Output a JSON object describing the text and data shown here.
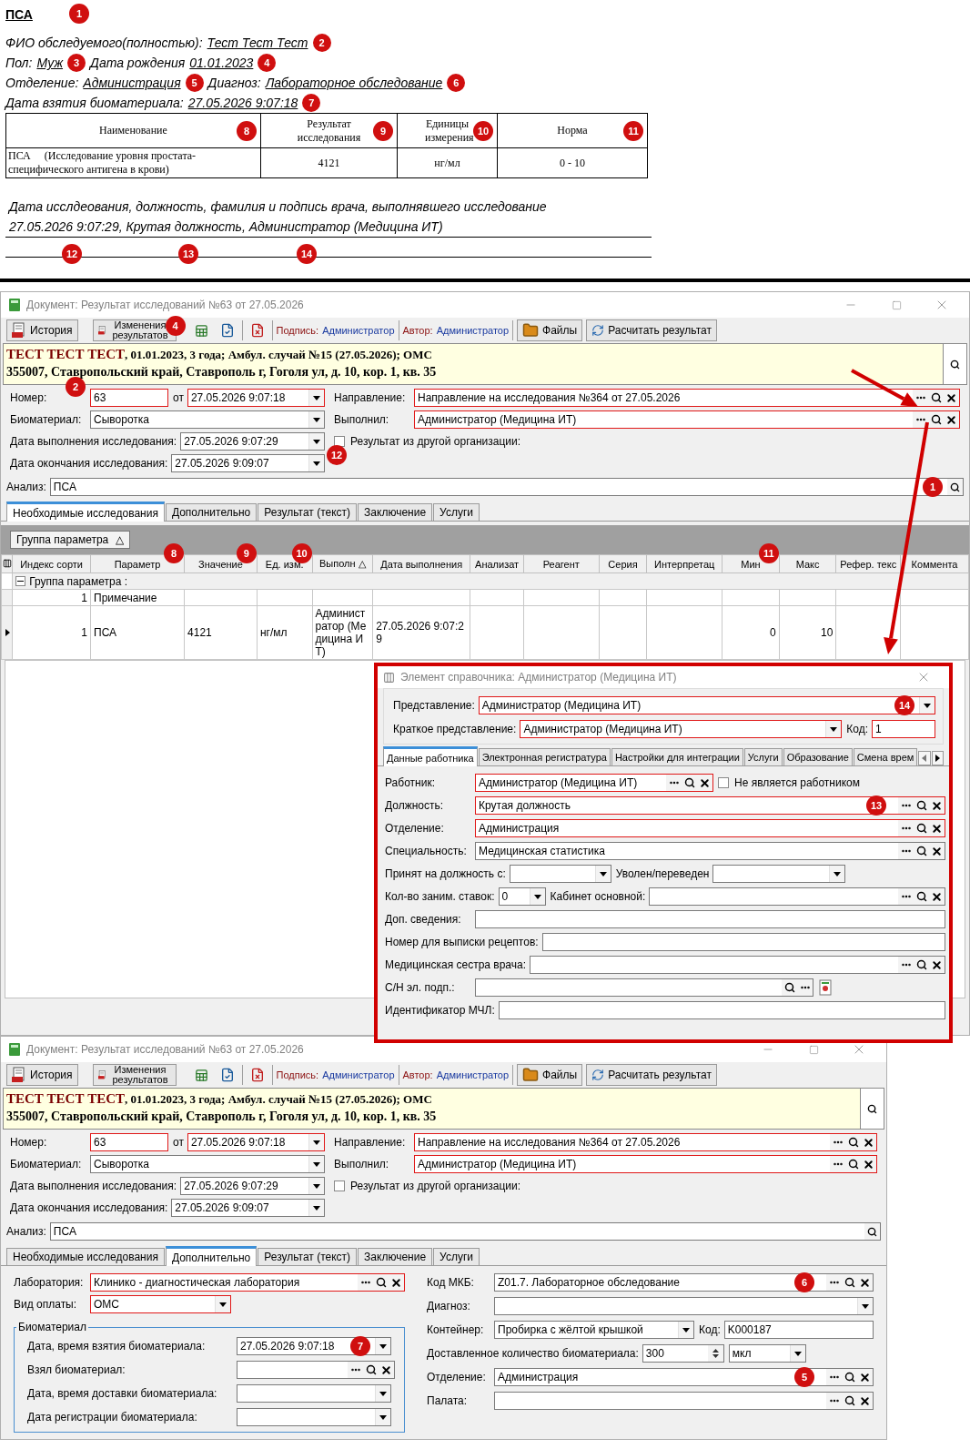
{
  "report": {
    "title": "ПСА",
    "title_callout": "1",
    "lines": [
      [
        {
          "kind": "label",
          "text": "ФИО обследуемого(полностью):"
        },
        {
          "kind": "value",
          "text": "Тест Тест Тест",
          "callout": "2"
        }
      ],
      [
        {
          "kind": "label",
          "text": "Пол:"
        },
        {
          "kind": "value",
          "text": "Муж",
          "callout": "3"
        },
        {
          "kind": "label",
          "text": "Дата рождения"
        },
        {
          "kind": "value",
          "text": "01.01.2023",
          "callout": "4"
        }
      ],
      [
        {
          "kind": "label",
          "text": "Отделение:"
        },
        {
          "kind": "value",
          "text": "Администрация",
          "callout": "5"
        },
        {
          "kind": "label",
          "text": "Диагноз:"
        },
        {
          "kind": "value",
          "text": "Лабораторное обследование",
          "callout": "6"
        }
      ],
      [
        {
          "kind": "label",
          "text": "Дата взятия биоматериала:"
        },
        {
          "kind": "value",
          "text": "27.05.2026 9:07:18",
          "callout": "7"
        }
      ]
    ],
    "table": {
      "columns": [
        {
          "text": "Наименование",
          "callout": "8"
        },
        {
          "text": "Результат исследования",
          "callout": "9"
        },
        {
          "text": "Единицы измерения",
          "callout": "10"
        },
        {
          "text": "Норма",
          "callout": "11"
        }
      ],
      "rows": [
        [
          "ПСА     (Исследование уровня простата-специфического антигена в крови)",
          "4121",
          "нг/мл",
          "0 - 10"
        ]
      ]
    },
    "signature": {
      "heading": "Дата исслдеования, должность, фамилия и подпись врача, выполнявшего исследование",
      "value": "27.05.2026 9:07:29, Крутая должность, Администратор (Медицина ИТ)",
      "callouts": [
        "12",
        "13",
        "14"
      ]
    }
  },
  "windows": [
    {
      "title": "Документ: Результат исследований №63 от 27.05.2026",
      "toolbar": {
        "buttons": [
          {
            "text": "История"
          },
          {
            "text": "Изменения результатов",
            "callout": "4"
          }
        ],
        "signed": {
          "label": "Подпись:",
          "value": "Администратор"
        },
        "author": {
          "label": "Автор:",
          "value": "Администратор"
        },
        "actions": [
          {
            "text": "Файлы"
          },
          {
            "text": "Расчитать результат"
          }
        ]
      },
      "patient": {
        "name": "ТЕСТ ТЕСТ ТЕСТ",
        "details": ", 01.01.2023, 3 года; Амбул. случай №15 (27.05.2026); ОМС",
        "address": "355007, Ставропольский край, Ставрополь г, Гоголя ул, д. 10, кор. 1, кв. 35",
        "callout": "2"
      },
      "form": {
        "left": [
          [
            {
              "kind": "text",
              "label": "Номер:",
              "value": "63",
              "required": true
            },
            {
              "kind": "combo",
              "label": "от",
              "value": "27.05.2026 9:07:18",
              "required": true
            }
          ],
          [
            {
              "kind": "combo",
              "label": "Биоматериал:",
              "value": "Сыворотка",
              "required": false
            }
          ],
          [
            {
              "kind": "combo",
              "label": "Дата выполнения исследования:",
              "value": "27.05.2026 9:07:29",
              "required": false,
              "callout": "12"
            }
          ],
          [
            {
              "kind": "combo",
              "label": "Дата окончания исследования:",
              "value": "27.05.2026 9:09:07",
              "required": false
            }
          ]
        ],
        "right": [
          [
            {
              "kind": "lookup",
              "label": "Направление:",
              "value": "Направление на исследования №364 от 27.05.2026",
              "required": true
            }
          ],
          [
            {
              "kind": "lookup",
              "label": "Выполнил:",
              "value": "Администратор (Медицина ИТ)",
              "required": true
            }
          ],
          [
            {
              "kind": "check",
              "label": "Результат из другой организации:",
              "checked": false
            }
          ]
        ]
      },
      "analysis": {
        "kind": "search",
        "label": "Анализ:",
        "value": "ПСА",
        "required": false,
        "callout": "1"
      },
      "tabs": [
        {
          "text": "Необходимые исследования",
          "selected": true
        },
        {
          "text": "Дополнительно",
          "selected": false
        },
        {
          "text": "Результат (текст)",
          "selected": false
        },
        {
          "text": "Заключение",
          "selected": false
        },
        {
          "text": "Услуги",
          "selected": false
        }
      ],
      "grid": {
        "group_chip": {
          "text": "Группа параметра",
          "sort": "△"
        },
        "columns": [
          {
            "text": "Индекс сорти"
          },
          {
            "text": "Параметр",
            "callout": "8"
          },
          {
            "text": "Значение",
            "callout": "9"
          },
          {
            "text": "Ед. изм.",
            "callout": "10"
          },
          {
            "text": "Выполн",
            "sort": "△"
          },
          {
            "text": "Дата выполнения"
          },
          {
            "text": "Анализат"
          },
          {
            "text": "Реагент"
          },
          {
            "text": "Серия"
          },
          {
            "text": "Интерпретац"
          },
          {
            "text": "Мин",
            "callout": "11"
          },
          {
            "text": "Макс"
          },
          {
            "text": "Рефер. текс"
          },
          {
            "text": "Коммента"
          }
        ],
        "group_row": {
          "text": "Группа параметра :",
          "expanded": true
        },
        "rows": [
          {
            "current": false,
            "cells": [
              "1",
              "Примечание",
              null,
              null,
              null,
              null,
              null,
              null,
              null,
              null,
              null,
              null,
              null,
              null
            ]
          },
          {
            "current": true,
            "cells": [
              "1",
              "ПСА",
              "4121",
              "нг/мл",
              "Администратор (Медицина ИТ)",
              "27.05.2026 9:07:29",
              null,
              null,
              null,
              null,
              "0",
              "10",
              null,
              null
            ]
          }
        ]
      },
      "dialog": {
        "title": "Элемент справочника: Администратор (Медицина ИТ)",
        "top": [
          [
            {
              "kind": "combo",
              "label": "Представление:",
              "value": "Администратор (Медицина ИТ)",
              "required": true,
              "callout": "14"
            }
          ],
          [
            {
              "kind": "combo",
              "label": "Краткое представление:",
              "value": "Администратор (Медицина ИТ)",
              "required": true
            },
            {
              "kind": "text",
              "label": "Код:",
              "value": "1",
              "required": true
            }
          ]
        ],
        "tabs": [
          {
            "text": "Данные работника",
            "selected": true
          },
          {
            "text": "Электронная регистратура",
            "selected": false
          },
          {
            "text": "Настройки для интеграции",
            "selected": false
          },
          {
            "text": "Услуги",
            "selected": false
          },
          {
            "text": "Образование",
            "selected": false
          },
          {
            "text": "Смена врем",
            "selected": false
          }
        ],
        "fields": [
          [
            {
              "kind": "lookup",
              "label": "Работник:",
              "value": "Администратор (Медицина ИТ)",
              "required": true
            },
            {
              "kind": "check",
              "label": "Не является работником",
              "checked": false
            }
          ],
          [
            {
              "kind": "lookup",
              "label": "Должность:",
              "value": "Крутая должность",
              "required": true,
              "callout": "13"
            }
          ],
          [
            {
              "kind": "lookup",
              "label": "Отделение:",
              "value": "Администрация",
              "required": true
            }
          ],
          [
            {
              "kind": "lookup",
              "label": "Специальность:",
              "value": "Медицинская статистика",
              "required": false
            }
          ],
          [
            {
              "kind": "combo",
              "label": "Принят на должность с:",
              "required": false
            },
            {
              "kind": "combo",
              "label": "Уволен/переведен",
              "required": false
            }
          ],
          [
            {
              "kind": "combo",
              "label": "Кол-во заним. ставок:",
              "value": "0",
              "required": false
            },
            {
              "kind": "lookup",
              "label": "Кабинет основной:",
              "required": false
            }
          ],
          [
            {
              "kind": "text",
              "label": "Доп. сведения:",
              "required": false
            }
          ],
          [
            {
              "kind": "text",
              "label": "Номер для выписки рецептов:",
              "required": false
            }
          ],
          [
            {
              "kind": "lookup",
              "label": "Медицинская сестра врача:",
              "required": false
            }
          ],
          [
            {
              "kind": "signature",
              "label": "С/Н эл. подп.:",
              "required": false
            }
          ],
          [
            {
              "kind": "text",
              "label": "Идентификатор МЧЛ:",
              "required": false
            }
          ]
        ]
      }
    },
    {
      "title": "Документ: Результат исследований №63 от 27.05.2026",
      "toolbar": {
        "buttons": [
          {
            "text": "История"
          },
          {
            "text": "Изменения результатов"
          }
        ],
        "signed": {
          "label": "Подпись:",
          "value": "Администратор"
        },
        "author": {
          "label": "Автор:",
          "value": "Администратор"
        },
        "actions": [
          {
            "text": "Файлы"
          },
          {
            "text": "Расчитать результат"
          }
        ]
      },
      "patient": {
        "name": "ТЕСТ ТЕСТ ТЕСТ",
        "details": ", 01.01.2023, 3 года; Амбул. случай №15 (27.05.2026); ОМС",
        "address": "355007, Ставропольский край, Ставрополь г, Гоголя ул, д. 10, кор. 1, кв. 35"
      },
      "form": {
        "left": [
          [
            {
              "kind": "text",
              "label": "Номер:",
              "value": "63",
              "required": true
            },
            {
              "kind": "combo",
              "label": "от",
              "value": "27.05.2026 9:07:18",
              "required": true
            }
          ],
          [
            {
              "kind": "combo",
              "label": "Биоматериал:",
              "value": "Сыворотка",
              "required": false
            }
          ],
          [
            {
              "kind": "combo",
              "label": "Дата выполнения исследования:",
              "value": "27.05.2026 9:07:29",
              "required": false
            }
          ],
          [
            {
              "kind": "combo",
              "label": "Дата окончания исследования:",
              "value": "27.05.2026 9:09:07",
              "required": false
            }
          ]
        ],
        "right": [
          [
            {
              "kind": "lookup",
              "label": "Направление:",
              "value": "Направление на исследования №364 от 27.05.2026",
              "required": true
            }
          ],
          [
            {
              "kind": "lookup",
              "label": "Выполнил:",
              "value": "Администратор (Медицина ИТ)",
              "required": true
            }
          ],
          [
            {
              "kind": "check",
              "label": "Результат из другой организации:",
              "checked": false
            }
          ]
        ]
      },
      "analysis": {
        "kind": "search",
        "label": "Анализ:",
        "value": "ПСА",
        "required": false
      },
      "tabs": [
        {
          "text": "Необходимые исследования",
          "selected": false
        },
        {
          "text": "Дополнительно",
          "selected": true
        },
        {
          "text": "Результат (текст)",
          "selected": false
        },
        {
          "text": "Заключение",
          "selected": false
        },
        {
          "text": "Услуги",
          "selected": false
        }
      ],
      "details": {
        "left": [
          [
            {
              "kind": "lookup",
              "label": "Лаборатория:",
              "value": "Клинико - диагностическая лаборатория",
              "required": true
            }
          ],
          [
            {
              "kind": "combo",
              "label": "Вид оплаты:",
              "value": "ОМС",
              "required": true
            }
          ]
        ],
        "group": {
          "title": "Биоматериал",
          "fields": [
            [
              {
                "kind": "combo",
                "label": "Дата, время взятия биоматериала:",
                "value": "27.05.2026 9:07:18",
                "required": false,
                "callout": "7"
              }
            ],
            [
              {
                "kind": "lookup",
                "label": "Взял биоматериал:",
                "required": false
              }
            ],
            [
              {
                "kind": "combo",
                "label": "Дата, время доставки биоматериала:",
                "required": false
              }
            ],
            [
              {
                "kind": "combo",
                "label": "Дата регистрации биоматериала:",
                "required": false
              }
            ]
          ]
        },
        "right": [
          [
            {
              "kind": "lookup",
              "label": "Код МКБ:",
              "value": "Z01.7. Лабораторное обследование",
              "required": false,
              "callout": "6"
            }
          ],
          [
            {
              "kind": "combo",
              "label": "Диагноз:",
              "required": false
            }
          ],
          [
            {
              "kind": "combo",
              "label": "Контейнер:",
              "value": "Пробирка с жёлтой крышкой",
              "required": false
            },
            {
              "kind": "text",
              "label": "Код:",
              "value": "K000187",
              "required": false
            }
          ],
          [
            {
              "kind": "spin",
              "label": "Доставленное количество биоматериала:",
              "value": "300",
              "required": false
            },
            {
              "kind": "combo",
              "value": "мкл",
              "required": false
            }
          ],
          [
            {
              "kind": "lookup",
              "label": "Отделение:",
              "value": "Администрация",
              "required": false,
              "callout": "5"
            }
          ],
          [
            {
              "kind": "lookup",
              "label": "Палата:",
              "required": false
            }
          ]
        ]
      }
    }
  ]
}
